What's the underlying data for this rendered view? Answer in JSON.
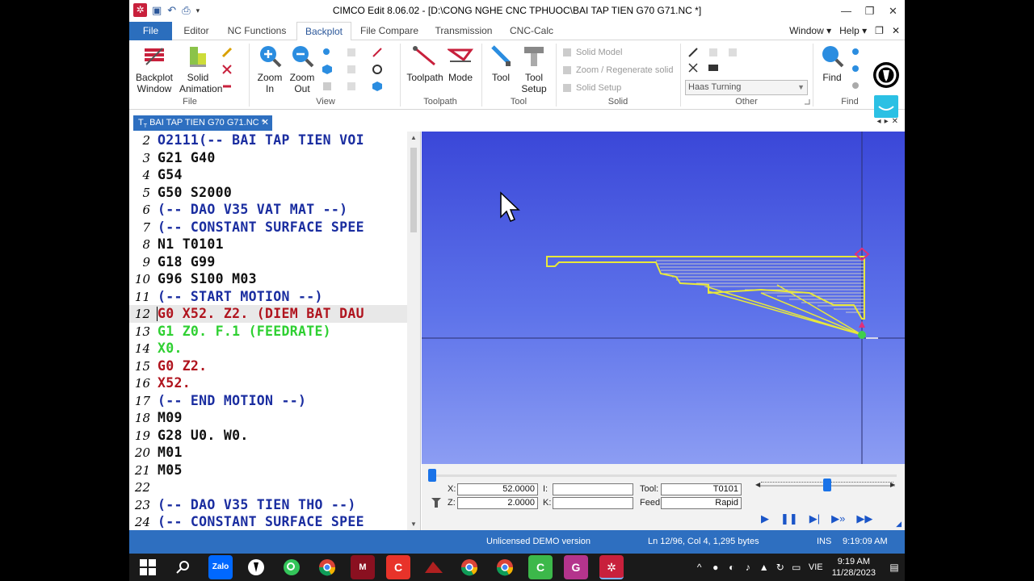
{
  "title": "CIMCO Edit 8.06.02 - [D:\\CONG NGHE CNC TPHUOC\\BAI TAP TIEN G70 G71.NC *]",
  "app_logo": "✲",
  "tabs": [
    "File",
    "Editor",
    "NC Functions",
    "Backplot",
    "File Compare",
    "Transmission",
    "CNC-Calc"
  ],
  "tabs_right": {
    "window": "Window ▾",
    "help": "Help ▾"
  },
  "ribbon": {
    "backplot_window": "Backplot\nWindow",
    "solid_animation": "Solid\nAnimation",
    "group_file": "File",
    "zoom_in": "Zoom\nIn",
    "zoom_out": "Zoom\nOut",
    "group_view": "View",
    "toolpath": "Toolpath",
    "mode": "Mode",
    "group_toolpath": "Toolpath",
    "tool": "Tool",
    "tool_setup": "Tool\nSetup",
    "group_tool": "Tool",
    "solid_model": "Solid Model",
    "zoom_regen": "Zoom / Regenerate solid",
    "solid_setup": "Solid Setup",
    "group_solid": "Solid",
    "machine_combo": "Haas Turning",
    "group_other": "Other",
    "find": "Find",
    "group_find": "Find"
  },
  "doc_tab": "BAI TAP TIEN G70 G71.NC *",
  "editor": {
    "lines": [
      {
        "n": "2",
        "text": "O2111(-- BAI TAP TIEN VOI",
        "color": "blue"
      },
      {
        "n": "3",
        "text": "G21 G40",
        "color": "black"
      },
      {
        "n": "4",
        "text": "G54",
        "color": "black"
      },
      {
        "n": "5",
        "text": "G50 S2000",
        "color": "black"
      },
      {
        "n": "6",
        "text": "(-- DAO V35 VAT MAT --)",
        "color": "blue"
      },
      {
        "n": "7",
        "text": "(-- CONSTANT SURFACE SPEE",
        "color": "blue"
      },
      {
        "n": "8",
        "text": "N1 T0101",
        "color": "black"
      },
      {
        "n": "9",
        "text": "G18 G99",
        "color": "black"
      },
      {
        "n": "10",
        "text": "G96 S100 M03",
        "color": "black"
      },
      {
        "n": "11",
        "text": "(-- START MOTION --)",
        "color": "blue"
      },
      {
        "n": "12",
        "text": "G0 X52. Z2. (DIEM BAT DAU",
        "color": "red"
      },
      {
        "n": "13",
        "text": "G1 Z0. F.1 (FEEDRATE)",
        "color": "green"
      },
      {
        "n": "14",
        "text": "X0.",
        "color": "green"
      },
      {
        "n": "15",
        "text": "G0 Z2.",
        "color": "red"
      },
      {
        "n": "16",
        "text": "X52.",
        "color": "red"
      },
      {
        "n": "17",
        "text": "(-- END MOTION --)",
        "color": "blue"
      },
      {
        "n": "18",
        "text": "M09",
        "color": "black"
      },
      {
        "n": "19",
        "text": "G28 U0. W0.",
        "color": "black"
      },
      {
        "n": "20",
        "text": "M01",
        "color": "black"
      },
      {
        "n": "21",
        "text": "M05",
        "color": "black"
      },
      {
        "n": "22",
        "text": "",
        "color": "black"
      },
      {
        "n": "23",
        "text": "(-- DAO V35 TIEN THO --)",
        "color": "blue"
      },
      {
        "n": "24",
        "text": "(-- CONSTANT SURFACE SPEE",
        "color": "blue"
      }
    ],
    "current_line_index": 10
  },
  "controls": {
    "x_label": "X:",
    "x_value": "52.0000",
    "z_label": "Z:",
    "z_value": "2.0000",
    "i_label": "I:",
    "i_value": "",
    "k_label": "K:",
    "k_value": "",
    "tool_label": "Tool:",
    "tool_value": "T0101",
    "feed_label": "Feed:",
    "feed_value": "Rapid",
    "position_progress": 0.0,
    "speed_progress": 0.5
  },
  "status": {
    "license": "Unlicensed DEMO version",
    "position": "Ln 12/96, Col 4, 1,295 bytes",
    "mode": "INS",
    "time": "9:19:09 AM"
  },
  "taskbar": {
    "lang": "VIE",
    "clock_time": "9:19 AM",
    "clock_date": "11/28/2023",
    "zalo": "Zalo"
  },
  "colors": {
    "accent": "#2e6fc0",
    "code_blue": "#1a2da0",
    "code_red": "#b0141e",
    "code_green": "#2fd032",
    "toolpath_yellow": "#e8e83a"
  }
}
